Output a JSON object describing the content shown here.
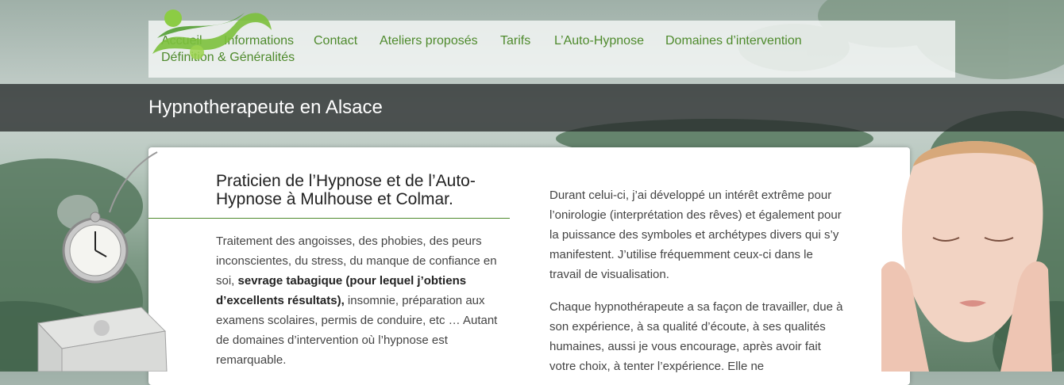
{
  "nav": {
    "items": [
      "Accueil",
      "Informations",
      "Contact",
      "Ateliers proposés",
      "Tarifs",
      "L’Auto-Hypnose",
      "Domaines d’intervention",
      "Définition & Généralités"
    ]
  },
  "header": {
    "title": "Hypnotherapeute en Alsace"
  },
  "main": {
    "heading": "Praticien de l’Hypnose et de l’Auto-Hypnose à Mulhouse et Colmar.",
    "left_para": {
      "part1": "Traitement des angoisses, des phobies, des peurs inconscientes, du stress, du manque de confiance en soi, ",
      "bold": "sevrage tabagique (pour lequel j’obtiens d’excellents résultats),",
      "part2": " insomnie, préparation aux examens scolaires, permis de conduire, etc … Autant de domaines d’intervention où l’hypnose est remarquable."
    },
    "right_para1": "Durant celui-ci, j’ai développé un intérêt extrême pour l’onirologie (interprétation des rêves) et également pour la puissance des symboles et archétypes divers qui s’y manifestent. J’utilise fréquemment ceux-ci dans le travail de visualisation.",
    "right_para2": "Chaque hypnothérapeute a sa façon de travailler, due à son expérience, à sa qualité d’écoute, à ses qualités humaines, aussi je vous encourage, après avoir fait votre choix, à tenter l’expérience. Elle ne"
  },
  "colors": {
    "accent": "#4e8a2c",
    "band": "#2c3030"
  },
  "icons": [
    "logo-swoosh-icon",
    "pocket-watch-icon",
    "silver-box-icon",
    "face-portrait-icon"
  ]
}
